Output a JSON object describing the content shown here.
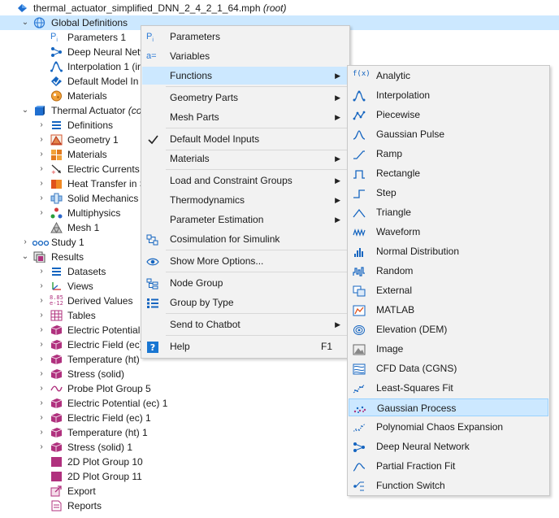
{
  "tree": {
    "root": {
      "label": "thermal_actuator_simplified_DNN_2_4_2_1_64.mph",
      "suffix": "(root)"
    },
    "global_definitions": "Global Definitions",
    "gd_children": [
      "Parameters 1",
      "Deep Neural Netw",
      "Interpolation 1 (ir",
      "Default Model In",
      "Materials"
    ],
    "component": {
      "label": "Thermal Actuator",
      "suffix": "(co"
    },
    "comp_children": [
      "Definitions",
      "Geometry 1",
      "Materials",
      "Electric Currents",
      "Heat Transfer in S",
      "Solid Mechanics",
      "Multiphysics",
      "Mesh 1"
    ],
    "study": "Study 1",
    "results": "Results",
    "results_children": [
      "Datasets",
      "Views",
      "Derived Values",
      "Tables",
      "Electric Potential",
      "Electric Field (ec)",
      "Temperature (ht)",
      "Stress (solid)",
      "Probe Plot Group 5",
      "Electric Potential (ec) 1",
      "Electric Field (ec) 1",
      "Temperature (ht) 1",
      "Stress (solid) 1",
      "2D Plot Group 10",
      "2D Plot Group 11",
      "Export",
      "Reports"
    ]
  },
  "context_menu": {
    "items": [
      {
        "label": "Parameters",
        "icon": "parameters-icon"
      },
      {
        "label": "Variables",
        "icon": "variables-icon"
      },
      {
        "label": "Functions",
        "submenu": true
      },
      {
        "label": "Geometry Parts",
        "submenu": true
      },
      {
        "label": "Mesh Parts",
        "submenu": true
      },
      {
        "label": "Default Model Inputs",
        "icon": "checkmark-icon"
      },
      {
        "label": "Materials",
        "submenu": true
      },
      {
        "label": "Load and Constraint Groups",
        "submenu": true
      },
      {
        "label": "Thermodynamics",
        "submenu": true
      },
      {
        "label": "Parameter Estimation",
        "submenu": true
      },
      {
        "label": "Cosimulation for Simulink",
        "icon": "cosimulation-icon"
      },
      {
        "label": "Show More Options...",
        "icon": "eye-icon"
      },
      {
        "label": "Node Group",
        "icon": "node-group-icon"
      },
      {
        "label": "Group by Type",
        "icon": "group-by-type-icon"
      },
      {
        "label": "Send to Chatbot",
        "submenu": true
      },
      {
        "label": "Help",
        "icon": "help-icon",
        "shortcut": "F1"
      }
    ]
  },
  "functions_menu": {
    "items": [
      "Analytic",
      "Interpolation",
      "Piecewise",
      "Gaussian Pulse",
      "Ramp",
      "Rectangle",
      "Step",
      "Triangle",
      "Waveform",
      "Normal Distribution",
      "Random",
      "External",
      "MATLAB",
      "Elevation (DEM)",
      "Image",
      "CFD Data (CGNS)",
      "Least-Squares Fit",
      "Gaussian Process",
      "Polynomial Chaos Expansion",
      "Deep Neural Network",
      "Partial Fraction Fit",
      "Function Switch"
    ],
    "highlighted": "Gaussian Process"
  },
  "colors": {
    "selection": "#cce8ff",
    "menu_bg": "#f2f2f2",
    "icon_blue": "#1565c0",
    "icon_purple": "#b0317e"
  }
}
